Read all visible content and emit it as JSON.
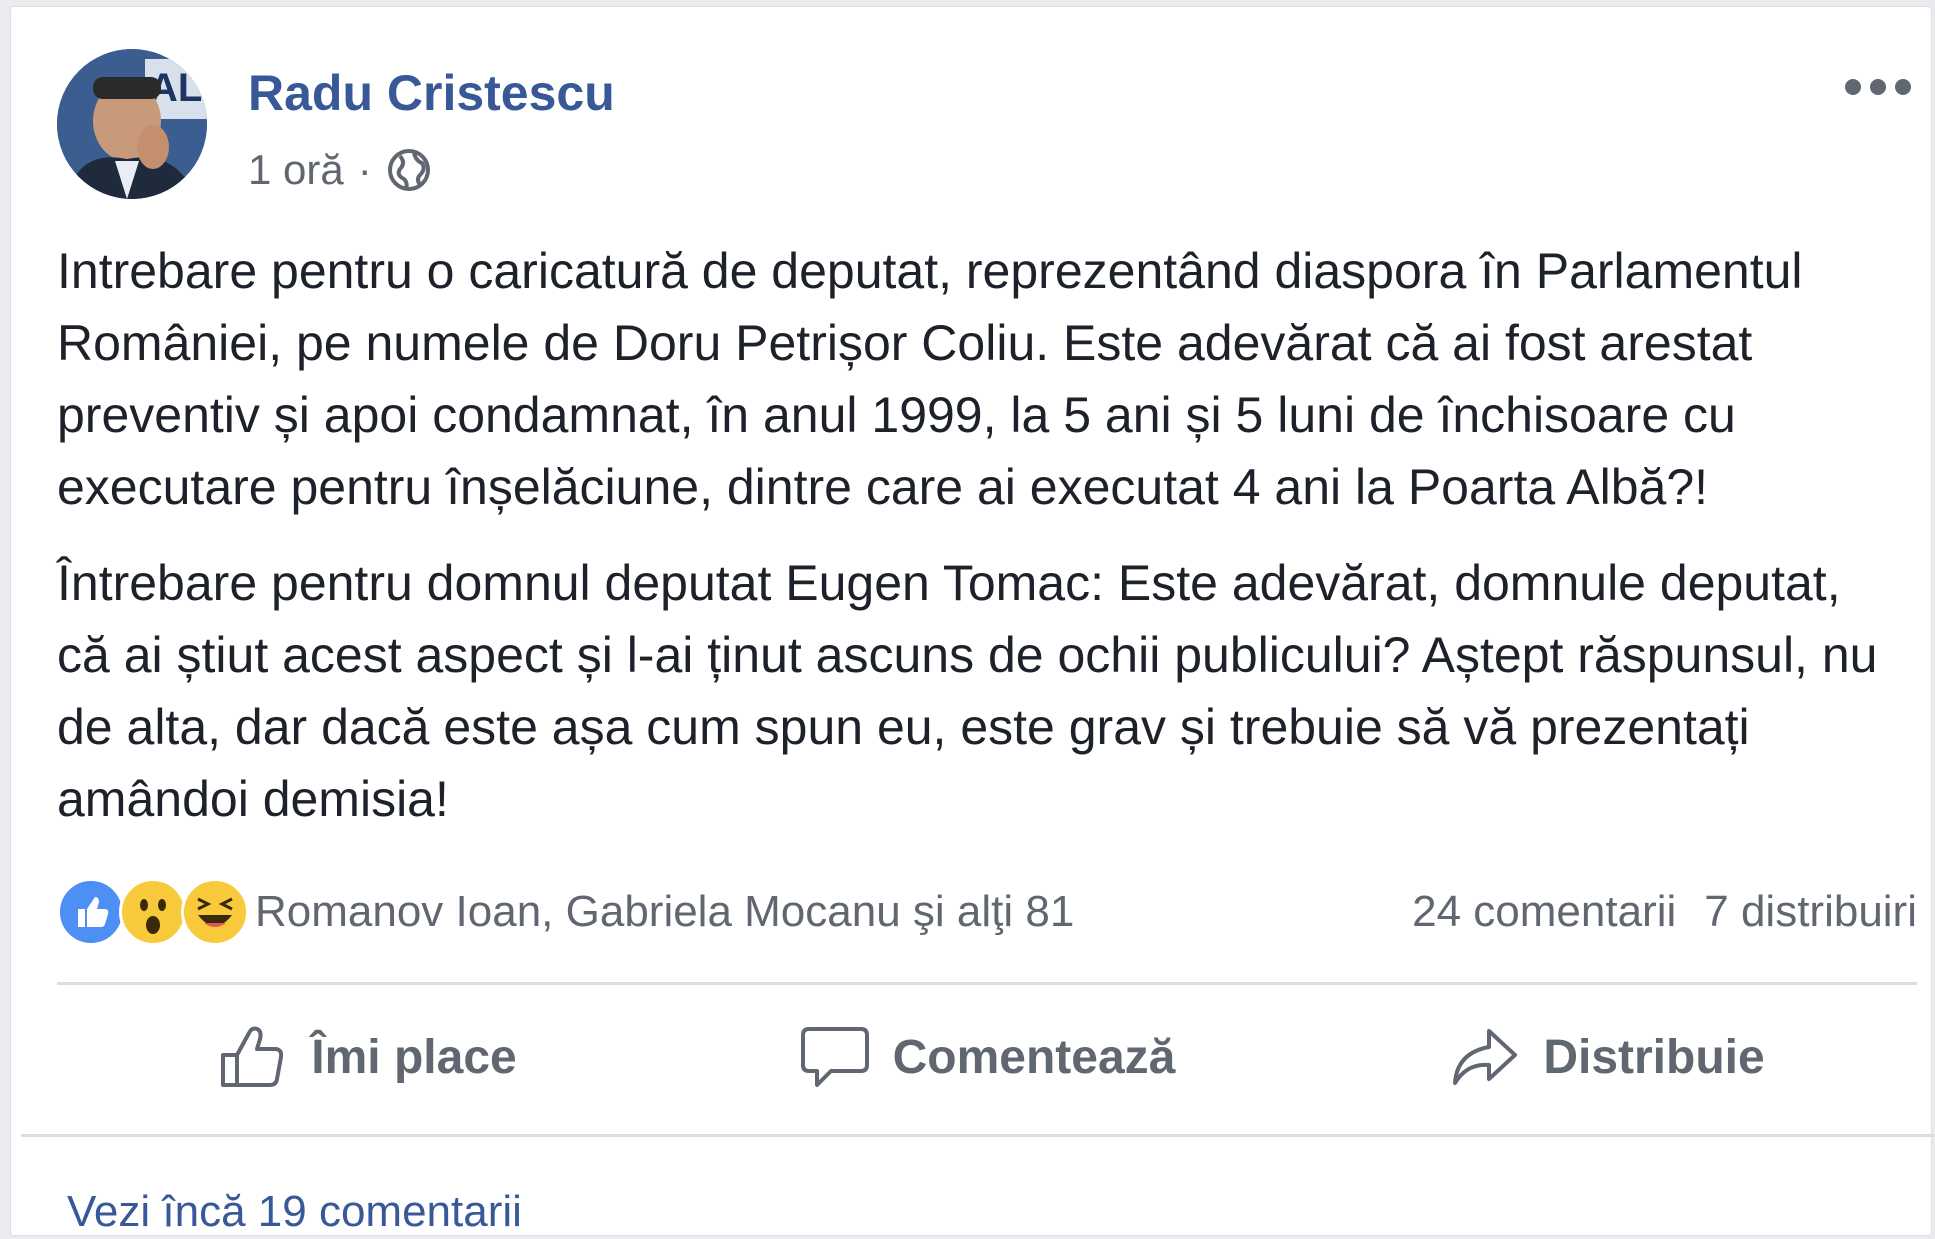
{
  "post": {
    "author": "Radu Cristescu",
    "time": "1 oră",
    "separator": "·",
    "visibility_icon": "globe-icon",
    "options_icon": "more-horizontal-icon",
    "paragraphs": [
      "Intrebare pentru o caricatură de deputat, reprezentând diaspora în Parlamentul României, pe numele de Doru Petrișor Coliu. Este adevărat că ai fost arestat preventiv și apoi condamnat, în anul 1999, la 5 ani și 5 luni de închisoare cu executare pentru înșelăciune, dintre care ai executat 4 ani la Poarta Albă?!",
      "Întrebare pentru domnul deputat Eugen Tomac: Este adevărat, domnule deputat, că ai știut acest aspect și l-ai ținut ascuns de ochii publicului? Aștept răspunsul, nu de alta, dar dacă este așa cum spun eu, este grav și trebuie să vă prezentați amândoi demisia!"
    ]
  },
  "reactions": {
    "icons": [
      "like-reaction-icon",
      "wow-reaction-icon",
      "haha-reaction-icon"
    ],
    "summary": "Romanov Ioan, Gabriela Mocanu şi alţi 81",
    "comments_count": "24 comentarii",
    "shares_count": "7 distribuiri"
  },
  "actions": {
    "like": "Îmi place",
    "comment": "Comentează",
    "share": "Distribuie"
  },
  "comments": {
    "view_more": "Vezi încă 19 comentarii"
  },
  "colors": {
    "link": "#385898",
    "text": "#1d2129",
    "secondary": "#616770",
    "like_blue": "#4e8ff6",
    "emoji_yellow": "#f7c93b"
  }
}
